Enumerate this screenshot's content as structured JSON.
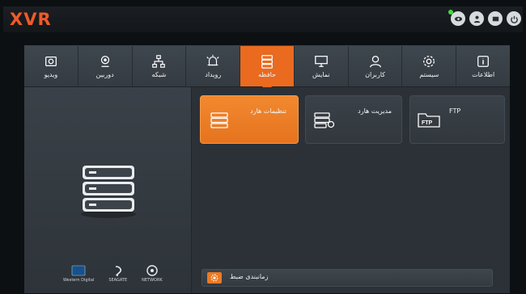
{
  "app": {
    "logo": "XVR"
  },
  "colors": {
    "accent": "#ea6a1f",
    "panel": "#2a3036",
    "logo": "#ef5a2a"
  },
  "topbar": {
    "icons": [
      "eye-icon",
      "user-icon",
      "monitor-icon",
      "power-icon"
    ]
  },
  "nav": {
    "active": "حافظه",
    "items": [
      {
        "label": "ویدیو",
        "icon": "camera-icon"
      },
      {
        "label": "دوربین",
        "icon": "webcam-icon"
      },
      {
        "label": "شبکه",
        "icon": "network-icon"
      },
      {
        "label": "رویداد",
        "icon": "alarm-icon"
      },
      {
        "label": "حافظه",
        "icon": "storage-icon"
      },
      {
        "label": "نمایش",
        "icon": "display-icon"
      },
      {
        "label": "کاربران",
        "icon": "user-icon"
      },
      {
        "label": "سیستم",
        "icon": "gear-icon"
      },
      {
        "label": "اطلاعات",
        "icon": "info-icon"
      }
    ]
  },
  "cards": {
    "hdd_settings": "تنظیمات هارد",
    "hdd_manage": "مدیریت هارد",
    "ftp": "FTP"
  },
  "brands": {
    "wd": "Western Digital",
    "seagate": "SEAGATE",
    "third": "NETWORK"
  },
  "schedule": {
    "label": "زمانبندی ضبط"
  }
}
